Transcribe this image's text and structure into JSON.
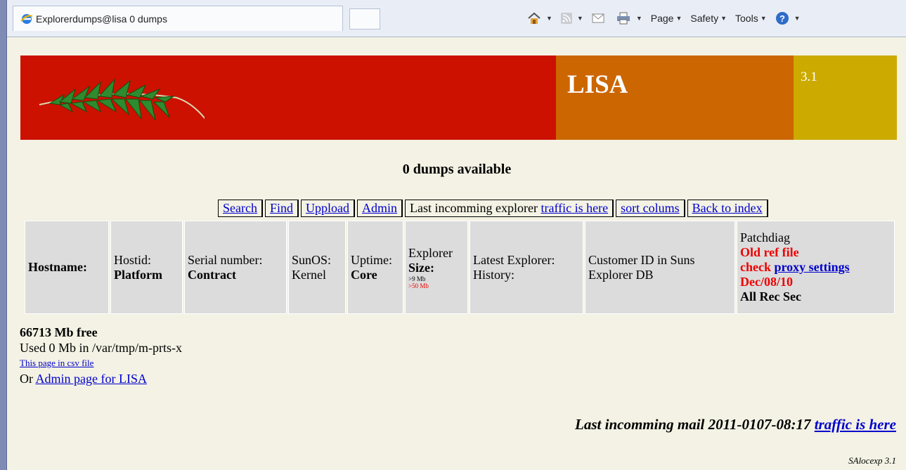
{
  "browser": {
    "tab_title": "Explorerdumps@lisa 0 dumps",
    "toolbar": {
      "page_label": "Page",
      "safety_label": "Safety",
      "tools_label": "Tools"
    }
  },
  "banner": {
    "title": "LISA",
    "version": "3.1",
    "colors": {
      "red": "#cc1100",
      "orange": "#cc6600",
      "gold": "#ccaa00"
    }
  },
  "main": {
    "dumps_heading": "0 dumps available",
    "nav": {
      "search": "Search",
      "find": "Find",
      "upload": "Uppload",
      "admin": "Admin",
      "last_prefix": "Last incomming explorer ",
      "traffic_link": "traffic is here",
      "sort": "sort colums",
      "back": "Back to index"
    },
    "table_header": {
      "hostname": "Hostname:",
      "hostid": "Hostid:",
      "platform": "Platform",
      "serial": "Serial number:",
      "contract": "Contract",
      "sunos": "SunOS:",
      "kernel": "Kernel",
      "uptime": "Uptime:",
      "core": "Core",
      "explorer": "Explorer",
      "size": "Size:",
      "size_small": ">9 Mb",
      "size_large": ">50 Mb",
      "latest": "Latest Explorer:",
      "history": "History:",
      "customer": "Customer ID in Suns Explorer DB",
      "patchdiag": "Patchdiag",
      "old_ref": "Old ref file",
      "check": "check",
      "proxy": "proxy settings",
      "date": "Dec/08/10",
      "allrecsec": "All Rec Sec"
    },
    "footer": {
      "free": "66713 Mb free",
      "used": "Used 0 Mb in /var/tmp/m-prts-x",
      "csv": "This page in csv file",
      "or": "Or ",
      "admin_link": "Admin page for LISA",
      "last_mail": "Last incomming mail 2011-0107-08:17 ",
      "traffic": "traffic is here",
      "saloc": "SAlocexp 3.1"
    }
  }
}
